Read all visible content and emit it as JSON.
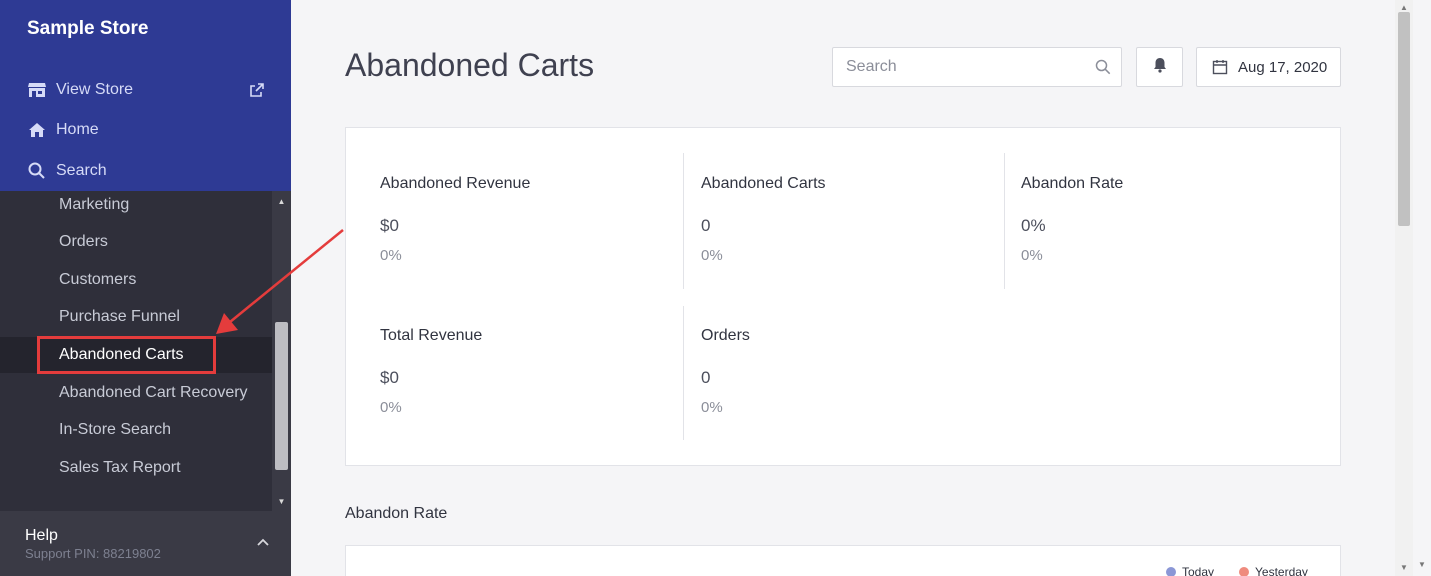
{
  "sidebar": {
    "store_name": "Sample Store",
    "top_links": [
      {
        "label": "View Store",
        "icon": "store-icon"
      },
      {
        "label": "Home",
        "icon": "home-icon"
      },
      {
        "label": "Search",
        "icon": "search-icon"
      }
    ],
    "menu_items": [
      {
        "label": "Marketing",
        "active": false
      },
      {
        "label": "Orders",
        "active": false
      },
      {
        "label": "Customers",
        "active": false
      },
      {
        "label": "Purchase Funnel",
        "active": false
      },
      {
        "label": "Abandoned Carts",
        "active": true
      },
      {
        "label": "Abandoned Cart Recovery",
        "active": false
      },
      {
        "label": "In-Store Search",
        "active": false
      },
      {
        "label": "Sales Tax Report",
        "active": false
      }
    ],
    "help": {
      "title": "Help",
      "support_pin": "Support PIN: 88219802"
    }
  },
  "header": {
    "title": "Abandoned Carts",
    "search_placeholder": "Search",
    "date": "Aug 17, 2020"
  },
  "stats": [
    {
      "label": "Abandoned Revenue",
      "value": "$0",
      "change": "0%"
    },
    {
      "label": "Abandoned Carts",
      "value": "0",
      "change": "0%"
    },
    {
      "label": "Abandon Rate",
      "value": "0%",
      "change": "0%"
    },
    {
      "label": "Total Revenue",
      "value": "$0",
      "change": "0%"
    },
    {
      "label": "Orders",
      "value": "0",
      "change": "0%"
    }
  ],
  "chart_section": {
    "title": "Abandon Rate",
    "legend": [
      {
        "label": "Today",
        "color": "#8b97d6"
      },
      {
        "label": "Yesterday",
        "color": "#ef8b7e"
      }
    ]
  },
  "colors": {
    "sidebar_top": "#2e3a94",
    "sidebar_bg": "#2f2f3a",
    "highlight": "#e43c3c"
  }
}
